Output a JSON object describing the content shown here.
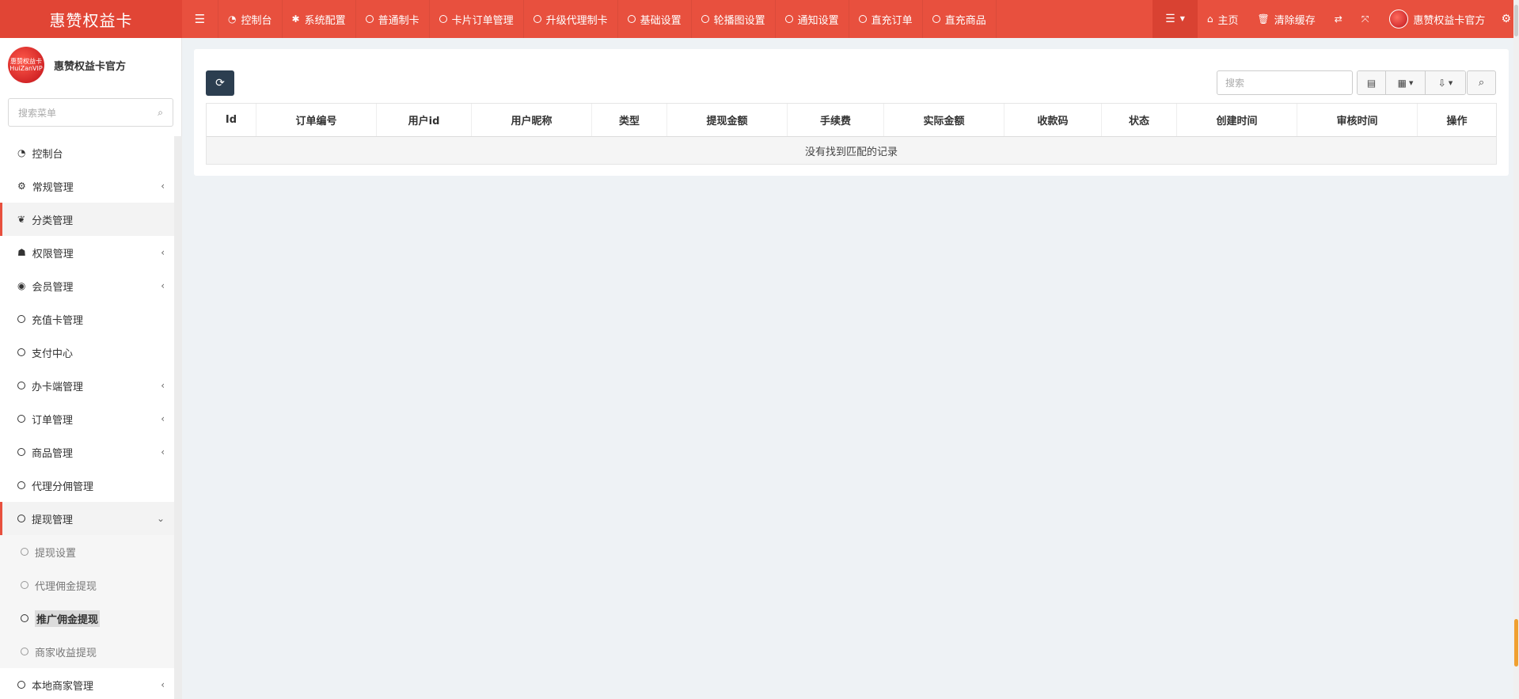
{
  "app": {
    "brand": "惠赞权益卡"
  },
  "topnav": {
    "items": [
      {
        "label": "控制台",
        "icon": "dashboard-icon"
      },
      {
        "label": "系统配置",
        "icon": "gear-icon"
      },
      {
        "label": "普通制卡",
        "icon": "circle-icon"
      },
      {
        "label": "卡片订单管理",
        "icon": "circle-icon"
      },
      {
        "label": "升级代理制卡",
        "icon": "circle-icon"
      },
      {
        "label": "基础设置",
        "icon": "circle-icon"
      },
      {
        "label": "轮播图设置",
        "icon": "circle-icon"
      },
      {
        "label": "通知设置",
        "icon": "circle-icon"
      },
      {
        "label": "直充订单",
        "icon": "circle-icon"
      },
      {
        "label": "直充商品",
        "icon": "circle-icon"
      }
    ],
    "right": {
      "home_label": "主页",
      "clear_cache_label": "清除缓存",
      "user_name": "惠赞权益卡官方"
    }
  },
  "sidebar": {
    "profile_name": "惠赞权益卡官方",
    "avatar_text": "惠赞权益卡 HuiZanVIP",
    "search_placeholder": "搜索菜单",
    "items": [
      {
        "label": "控制台",
        "icon": "dashboard-icon",
        "has_children": false
      },
      {
        "label": "常规管理",
        "icon": "cogs-icon",
        "has_children": true
      },
      {
        "label": "分类管理",
        "icon": "leaf-icon",
        "has_children": false,
        "active": true
      },
      {
        "label": "权限管理",
        "icon": "group-icon",
        "has_children": true
      },
      {
        "label": "会员管理",
        "icon": "user-circle-icon",
        "has_children": true
      },
      {
        "label": "充值卡管理",
        "icon": "circle-icon",
        "has_children": false
      },
      {
        "label": "支付中心",
        "icon": "circle-icon",
        "has_children": false
      },
      {
        "label": "办卡端管理",
        "icon": "circle-icon",
        "has_children": true
      },
      {
        "label": "订单管理",
        "icon": "circle-icon",
        "has_children": true
      },
      {
        "label": "商品管理",
        "icon": "circle-icon",
        "has_children": true
      },
      {
        "label": "代理分佣管理",
        "icon": "circle-icon",
        "has_children": false
      },
      {
        "label": "提现管理",
        "icon": "circle-icon",
        "has_children": true,
        "expanded": true
      },
      {
        "label": "本地商家管理",
        "icon": "circle-icon",
        "has_children": true
      }
    ],
    "withdraw_sub": [
      {
        "label": "提现设置"
      },
      {
        "label": "代理佣金提现"
      },
      {
        "label": "推广佣金提现",
        "current": true
      },
      {
        "label": "商家收益提现"
      }
    ]
  },
  "toolbar": {
    "search_placeholder": "搜索"
  },
  "table": {
    "columns": [
      "Id",
      "订单编号",
      "用户id",
      "用户昵称",
      "类型",
      "提现金额",
      "手续费",
      "实际金额",
      "收款码",
      "状态",
      "创建时间",
      "审核时间",
      "操作"
    ],
    "empty_text": "没有找到匹配的记录"
  }
}
